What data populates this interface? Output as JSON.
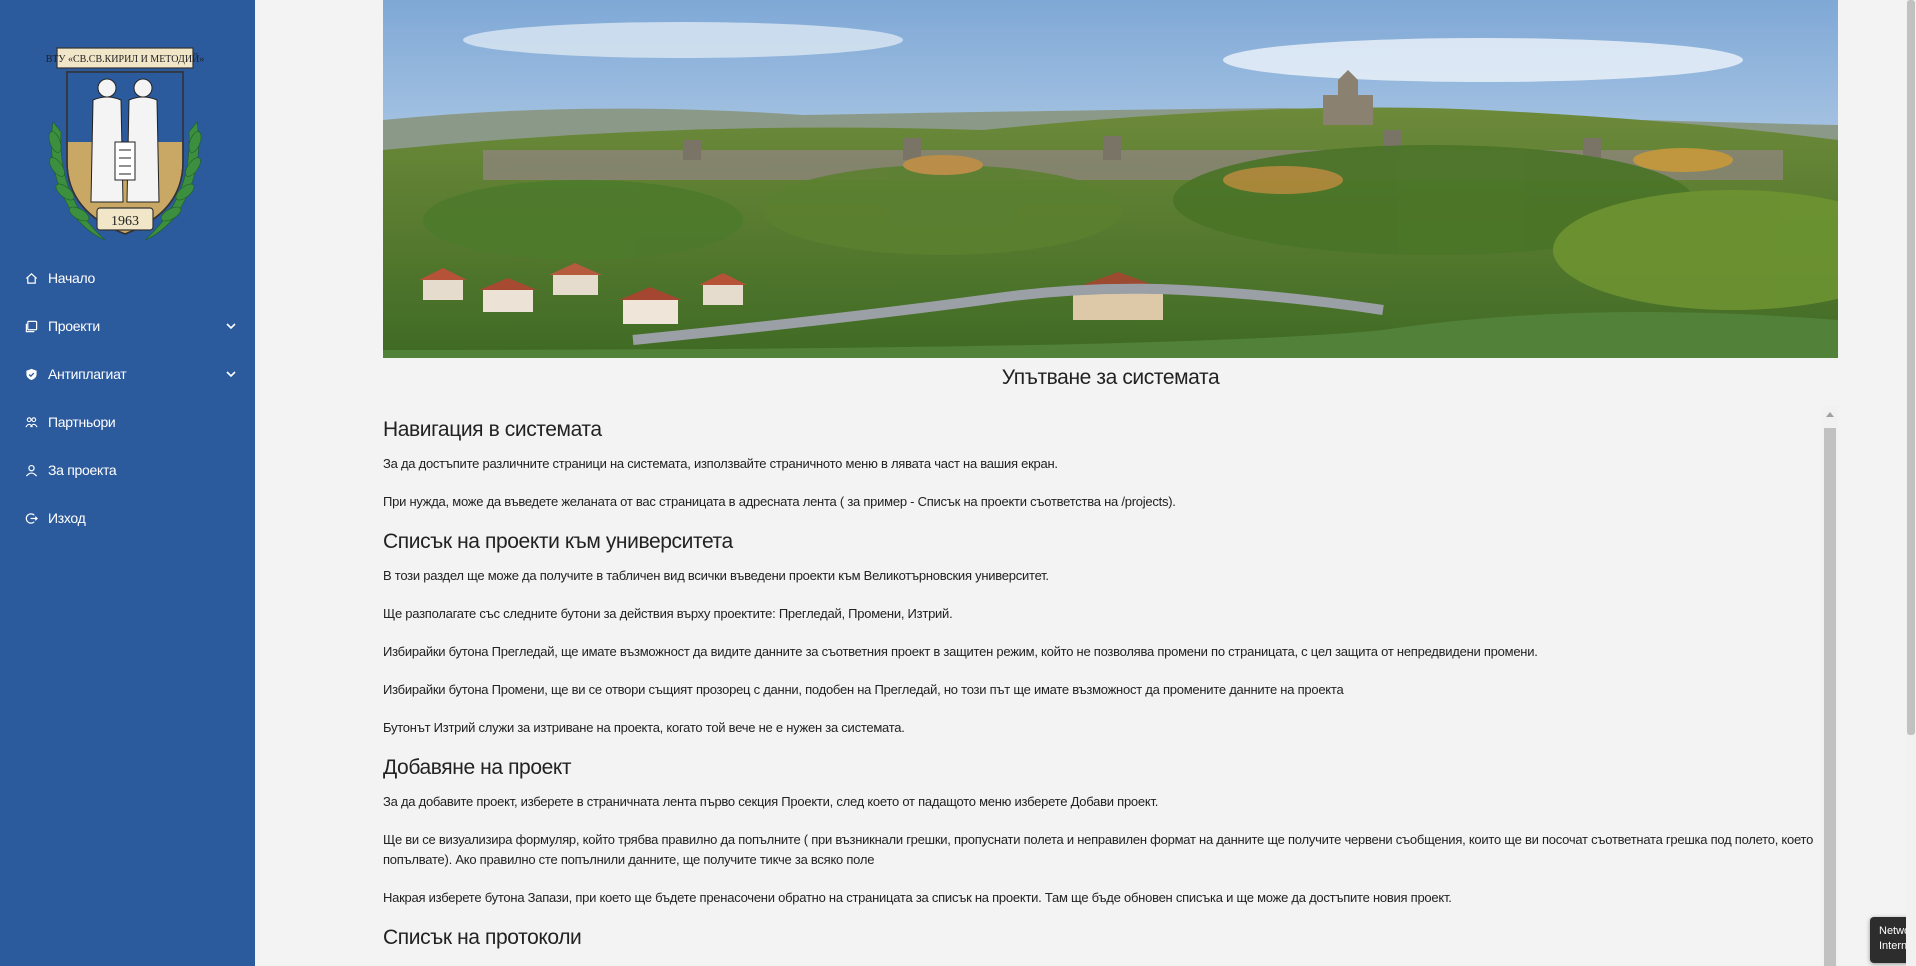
{
  "sidebar": {
    "logo_name": "VTU Sv. Kiril i Metodiy crest",
    "logo_text": "ВТУ «СВ.СВ.КИРИЛ И МЕТОДИЙ»",
    "logo_year": "1963",
    "items": [
      {
        "label": "Начало",
        "icon": "home-icon",
        "has_submenu": false
      },
      {
        "label": "Проекти",
        "icon": "projects-icon",
        "has_submenu": true
      },
      {
        "label": "Антиплагиат",
        "icon": "shield-icon",
        "has_submenu": true
      },
      {
        "label": "Партньори",
        "icon": "partners-icon",
        "has_submenu": false
      },
      {
        "label": "За проекта",
        "icon": "user-icon",
        "has_submenu": false
      },
      {
        "label": "Изход",
        "icon": "logout-icon",
        "has_submenu": false
      }
    ],
    "bg_color": "#2b5a9d"
  },
  "main": {
    "hero_alt": "Veliko Tarnovo panorama",
    "title": "Упътване за системата",
    "sections": [
      {
        "heading": "Навигация в системата",
        "paragraphs": [
          "За да достъпите различните страници на системата, използвайте страничното меню в лявата част на вашия екран.",
          "При нужда, може да въведете желаната от вас страницата в адресната лента ( за пример - Списък на проекти съответства на /projects)."
        ]
      },
      {
        "heading": "Списък на проекти към университета",
        "paragraphs": [
          "В този раздел ще може да получите в табличен вид всички въведени проекти към Великотърновския университет.",
          "Ще разполагате със следните бутони за действия върху проектите: Прегледай, Промени, Изтрий.",
          "Избирайки бутона Прегледай, ще имате възможност да видите данните за съответния проект в защитен режим, който не позволява промени по страницата, с цел защита от непредвидени промени.",
          "Избирайки бутона Промени, ще ви се отвори същият прозорец с данни, подобен на Прегледай, но този път ще имате възможност да промените данните на проекта",
          "Бутонът Изтрий служи за изтриване на проекта, когато той вече не е нужен за системата."
        ]
      },
      {
        "heading": "Добавяне на проект",
        "paragraphs": [
          "За да добавите проект, изберете в страничната лента първо секция Проекти, след което от падащото меню изберете Добави проект.",
          "Ще ви се визуализира формуляр, който трябва правилно да попълните ( при възникнали грешки, пропуснати полета и неправилен формат на данните ще получите червени съобщения, които ще ви посочат съответната грешка под полето, което попълвате). Ако правилно сте попълнили данните, ще получите тикче за всяко поле",
          "Накрая изберете бутона Запази, при което ще бъдете пренасочени обратно на страницата за списък на проекти. Там ще бъде обновен списъка и ще може да достъпите новия проект."
        ]
      },
      {
        "heading": "Списък на протоколи",
        "paragraphs": []
      }
    ]
  },
  "toast": {
    "line1": "Network",
    "line2": "Internet access"
  }
}
